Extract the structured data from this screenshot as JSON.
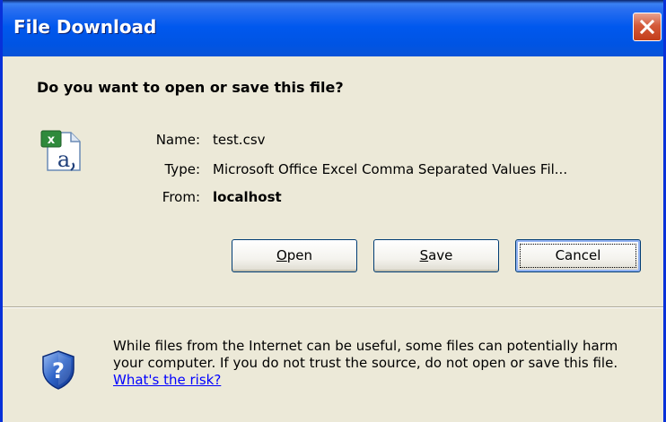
{
  "window": {
    "title": "File Download"
  },
  "dialog": {
    "question": "Do you want to open or save this file?",
    "file": {
      "icon": "excel-csv-file-icon",
      "name_label": "Name:",
      "name_value": "test.csv",
      "type_label": "Type:",
      "type_value": "Microsoft Office Excel Comma Separated Values Fil...",
      "from_label": "From:",
      "from_value": "localhost"
    },
    "buttons": {
      "open": {
        "pre": "",
        "mnemonic": "O",
        "post": "pen"
      },
      "save": {
        "pre": "",
        "mnemonic": "S",
        "post": "ave"
      },
      "cancel": "Cancel"
    },
    "warning": {
      "icon": "security-shield-question-icon",
      "text": "While files from the Internet can be useful, some files can potentially harm your computer. If you do not trust the source, do not open or save this file.",
      "link": "What's the risk?"
    }
  },
  "colors": {
    "titlebar": "#0054e3",
    "dialog_bg": "#ece9d8",
    "close_button": "#d45a3a",
    "link": "#0000ff"
  }
}
